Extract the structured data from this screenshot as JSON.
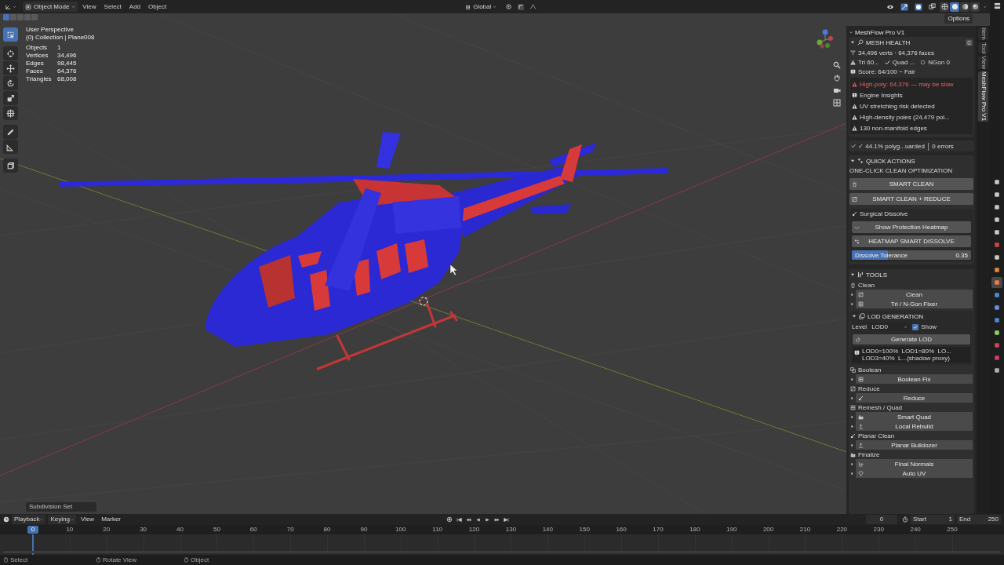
{
  "header": {
    "mode": "Object Mode",
    "menus": [
      "View",
      "Select",
      "Add",
      "Object"
    ],
    "orientation": "Global",
    "options": "Options"
  },
  "selection_modes": [
    {
      "selected": true
    },
    {
      "selected": false
    },
    {
      "selected": false
    },
    {
      "selected": false
    },
    {
      "selected": false
    }
  ],
  "shading_modes": [
    {
      "selected": false
    },
    {
      "selected": true
    },
    {
      "selected": false
    },
    {
      "selected": false
    }
  ],
  "toolbar": [
    {
      "selected": true
    },
    {
      "selected": false
    },
    {
      "selected": false
    },
    {
      "selected": false
    },
    {
      "selected": false
    },
    {
      "selected": false
    },
    {
      "selected": false
    },
    {
      "selected": false
    },
    {
      "selected": false
    }
  ],
  "viewport_info": {
    "perspective": "User Perspective",
    "collection": "(0) Collection | Plane008"
  },
  "stats": [
    {
      "label": "Objects",
      "value": "1"
    },
    {
      "label": "Vertices",
      "value": "34,496"
    },
    {
      "label": "Edges",
      "value": "98,445"
    },
    {
      "label": "Faces",
      "value": "64,376"
    },
    {
      "label": "Triangles",
      "value": "68,008"
    }
  ],
  "operator_panel": {
    "title": "Subdivision Set"
  },
  "n_panel": {
    "title": "MeshFlow Pro V1",
    "mesh_health": {
      "title": "MESH HEALTH",
      "summary": "34,496 verts · 64,376 faces",
      "topology": [
        "Tri 60...",
        "Quad ...",
        "NGon 0"
      ],
      "score": "Score: 64/100 ~ Fair",
      "alerts": [
        {
          "kind": "error",
          "text": "High-poly: 64,376 — may be slow"
        },
        {
          "kind": "info",
          "text": "Engine Insights"
        },
        {
          "kind": "warning",
          "text": "UV stretching risk detected"
        },
        {
          "kind": "warning",
          "text": "High-density poles (24,479 pol..."
        },
        {
          "kind": "warning",
          "text": "130 non-manifold edges"
        }
      ],
      "status": "✓ 44.1% polyg...uarded │ 0 errors"
    },
    "quick_actions": {
      "title": "QUICK ACTIONS",
      "subtitle": "ONE-CLICK CLEAN OPTIMIZATION",
      "buttons": [
        "SMART CLEAN",
        "SMART CLEAN + REDUCE"
      ],
      "surgical": {
        "title": "Surgical Dissolve",
        "buttons": [
          "Show Protection Heatmap",
          "HEATMAP SMART DISSOLVE"
        ],
        "slider": {
          "label": "Dissolve Tolerance",
          "value": "0.35",
          "level": 0.3
        }
      }
    },
    "tools": {
      "title": "TOOLS",
      "items": [
        {
          "kind": "group",
          "label": "Clean",
          "operators": [
            "Clean",
            "Tri / N-Gon Fixer"
          ]
        },
        {
          "kind": "lod",
          "title": "LOD GENERATION",
          "level_label": "Level",
          "level_value": "LOD0",
          "show_label": "Show",
          "show_checked": true,
          "button": "Generate LOD",
          "info": [
            "LOD0=100%  LOD1=80%  LO...",
            "LOD3=40%  L...(shadow proxy)"
          ]
        },
        {
          "kind": "group",
          "label": "Boolean",
          "operators": [
            "Boolean Fix"
          ]
        },
        {
          "kind": "group",
          "label": "Reduce",
          "operators": [
            "Reduce"
          ]
        },
        {
          "kind": "group",
          "label": "Remesh / Quad",
          "operators": [
            "Smart Quad",
            "Local Rebuild"
          ]
        },
        {
          "kind": "group",
          "label": "Planar Clean",
          "operators": [
            "Planar Bulldozer"
          ]
        },
        {
          "kind": "group",
          "label": "Finalize",
          "operators": [
            "Final Normals",
            "Auto UV"
          ]
        }
      ]
    }
  },
  "tabs": [
    {
      "label": "Item",
      "selected": false
    },
    {
      "label": "Tool",
      "selected": false
    },
    {
      "label": "View",
      "selected": false
    },
    {
      "label": "MeshFlow Pro V1",
      "selected": true
    }
  ],
  "properties_tabs": [
    {
      "selected": false
    },
    {
      "selected": false
    },
    {
      "selected": false
    },
    {
      "selected": false
    },
    {
      "selected": false
    },
    {
      "selected": false
    },
    {
      "selected": false
    },
    {
      "selected": false
    },
    {
      "selected": true
    },
    {
      "selected": false
    },
    {
      "selected": false
    },
    {
      "selected": false
    },
    {
      "selected": false
    },
    {
      "selected": false
    },
    {
      "selected": false
    },
    {
      "selected": false
    }
  ],
  "timeline": {
    "menus": [
      "Playback",
      "Keying",
      "View",
      "Marker"
    ],
    "current_frame": "0",
    "start_label": "Start",
    "start": "1",
    "end_label": "End",
    "end": "250",
    "playhead": "0",
    "ruler": [
      "10",
      "20",
      "30",
      "40",
      "50",
      "60",
      "70",
      "80",
      "90",
      "100",
      "110",
      "120",
      "130",
      "140",
      "150",
      "160",
      "170",
      "180",
      "190",
      "200",
      "210",
      "220",
      "230",
      "240",
      "250"
    ]
  },
  "status_bar": [
    "Select",
    "Rotate View",
    "Object"
  ]
}
